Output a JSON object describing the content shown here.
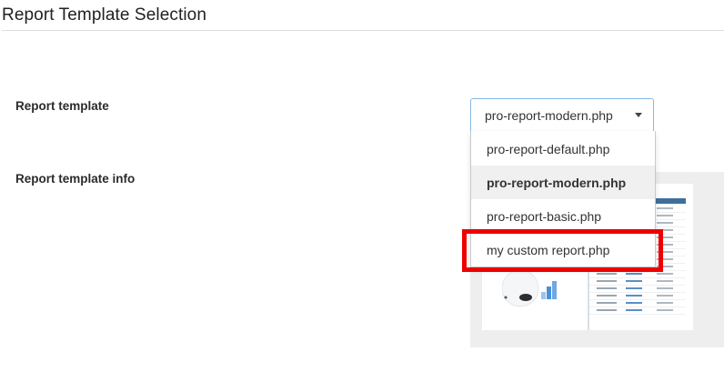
{
  "section": {
    "title": "Report Template Selection"
  },
  "fields": {
    "template_label": "Report template",
    "info_label": "Report template info"
  },
  "select": {
    "current_value": "pro-report-modern.php",
    "caret_icon": "caret-down-icon"
  },
  "dropdown": {
    "options": [
      {
        "label": "pro-report-default.php",
        "selected": false
      },
      {
        "label": "pro-report-modern.php",
        "selected": true
      },
      {
        "label": "pro-report-basic.php",
        "selected": false
      },
      {
        "label": "my custom report.php",
        "selected": false
      }
    ]
  },
  "highlight": {
    "target_option": "my custom report.php",
    "color": "#ef0000"
  },
  "colors": {
    "select_border": "#86b7e8",
    "selected_option_bg": "#f0f0f0",
    "preview_header": "#3f6f9c"
  }
}
